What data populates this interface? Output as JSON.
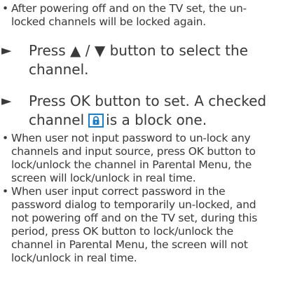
{
  "bullets_top": [
    {
      "marker": "•",
      "lines": [
        "After powering off and on the TV set, the un-",
        "locked channels will be locked again."
      ]
    }
  ],
  "steps": [
    {
      "marker": "►",
      "lines": [
        "Press ▲ / ▼ button to select the",
        "channel."
      ]
    },
    {
      "marker": "►",
      "line1": "Press OK button to set. A checked",
      "line2_before": "channel",
      "line2_after": "is a block one.",
      "icon": "lock-icon",
      "icon_color": "#1f7ec8"
    }
  ],
  "bullets_bottom": [
    {
      "marker": "•",
      "lines": [
        "When user not input password to un-lock any",
        "channels and input source, press OK button to",
        "lock/unlock the channel in Parental Menu, the",
        "screen will lock/unlock in real time."
      ]
    },
    {
      "marker": "•",
      "lines": [
        "When user input correct password in the",
        "password dialog to temporarily un-locked, and",
        "not powering off and on the TV set, during this",
        "period, press OK button to lock/unlock the",
        "channel in Parental Menu, the screen will not",
        "lock/unlock in real time."
      ]
    }
  ]
}
